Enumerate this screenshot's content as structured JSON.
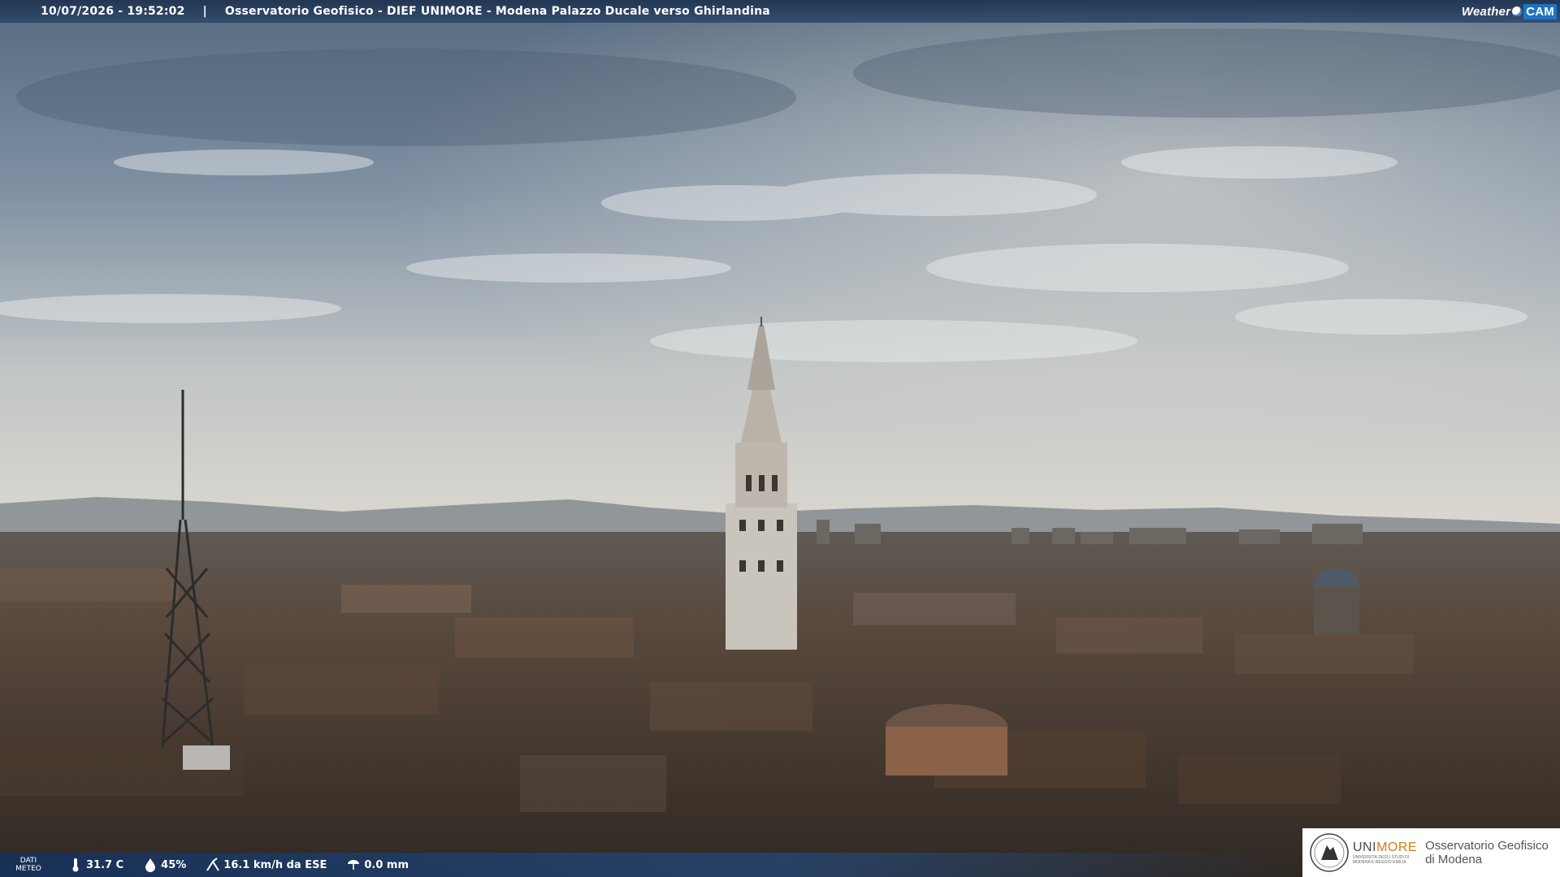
{
  "header": {
    "timestamp": "10/07/2026 - 19:52:02",
    "separator": "|",
    "caption": "Osservatorio Geofisico - DIEF UNIMORE - Modena Palazzo Ducale verso Ghirlandina"
  },
  "brand": {
    "weather": "Weather",
    "cam": "CAM"
  },
  "weather_bar": {
    "label_line1": "DATI",
    "label_line2": "METEO",
    "temperature": "31.7 C",
    "humidity": "45%",
    "wind": "16.1 km/h da ESE",
    "rain": "0.0 mm",
    "icons": [
      "thermometer-icon",
      "droplet-icon",
      "wind-icon",
      "rain-icon"
    ]
  },
  "logo": {
    "uni": "UNI",
    "more": "MORE",
    "sub_line1": "UNIVERSITÀ DEGLI STUDI DI",
    "sub_line2": "MODENA E REGGIO EMILIA",
    "observatory_line1": "Osservatorio Geofisico",
    "observatory_line2": "di Modena"
  },
  "colors": {
    "bar_blue": "#1e4680",
    "cam_blue": "#1e74c2",
    "unimore_orange": "#d77b1a",
    "sky_top": "#5a6f85",
    "sky_horizon": "#d9d6cf",
    "roofs": "#4a3d33"
  }
}
